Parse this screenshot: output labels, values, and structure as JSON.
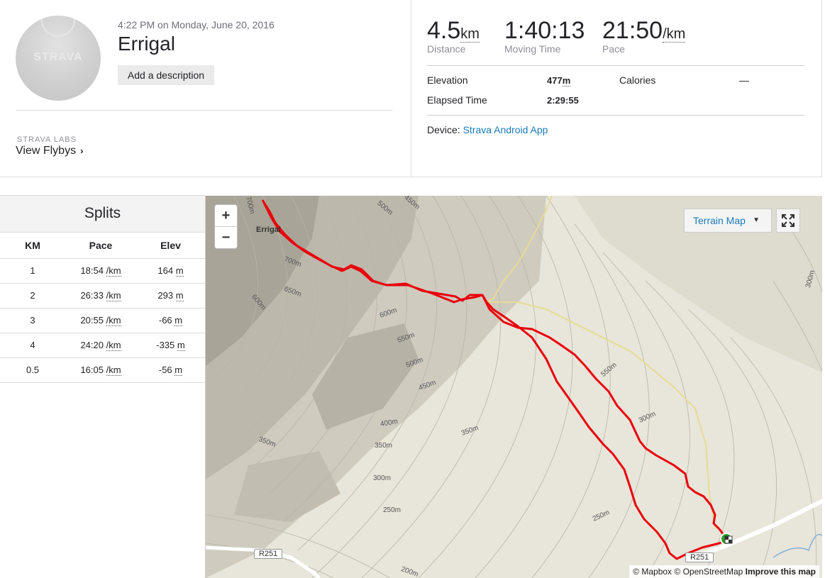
{
  "header": {
    "avatar_logo": "STRAVA",
    "date": "4:22 PM on Monday, June 20, 2016",
    "title": "Errigal",
    "add_description": "Add a description",
    "labs_label": "STRAVA LABS",
    "flybys_link": "View Flybys"
  },
  "stats": {
    "distance": {
      "value": "4.5",
      "unit": "km",
      "label": "Distance"
    },
    "moving_time": {
      "value": "1:40:13",
      "label": "Moving Time"
    },
    "pace": {
      "value": "21:50",
      "unit": "/km",
      "label": "Pace"
    },
    "elevation_label": "Elevation",
    "elevation_value": "477",
    "elevation_unit": "m",
    "calories_label": "Calories",
    "calories_value": "—",
    "elapsed_label": "Elapsed Time",
    "elapsed_value": "2:29:55",
    "device_label": "Device:",
    "device_value": "Strava Android App"
  },
  "splits": {
    "title": "Splits",
    "columns": [
      "KM",
      "Pace",
      "Elev"
    ],
    "pace_unit": "/km",
    "elev_unit": "m",
    "rows": [
      {
        "km": "1",
        "pace": "18:54",
        "elev": "164"
      },
      {
        "km": "2",
        "pace": "26:33",
        "elev": "293"
      },
      {
        "km": "3",
        "pace": "20:55",
        "elev": "-66"
      },
      {
        "km": "4",
        "pace": "24:20",
        "elev": "-335"
      },
      {
        "km": "0.5",
        "pace": "16:05",
        "elev": "-56"
      }
    ]
  },
  "map": {
    "zoom_in": "+",
    "zoom_out": "−",
    "terrain_button": "Terrain Map",
    "peak_label": "Errigal",
    "road_label": "R251",
    "attribution_mapbox": "© Mapbox",
    "attribution_osm": "© OpenStreetMap",
    "attribution_improve": "Improve this map",
    "route_color": "#e8000b",
    "contour_labels": [
      "700m",
      "700m",
      "650m",
      "600m",
      "600m",
      "550m",
      "500m",
      "450m",
      "400m",
      "350m",
      "350m",
      "350m",
      "300m",
      "300m",
      "300m",
      "250m",
      "250m",
      "200m",
      "550m",
      "500m",
      "450m"
    ]
  }
}
